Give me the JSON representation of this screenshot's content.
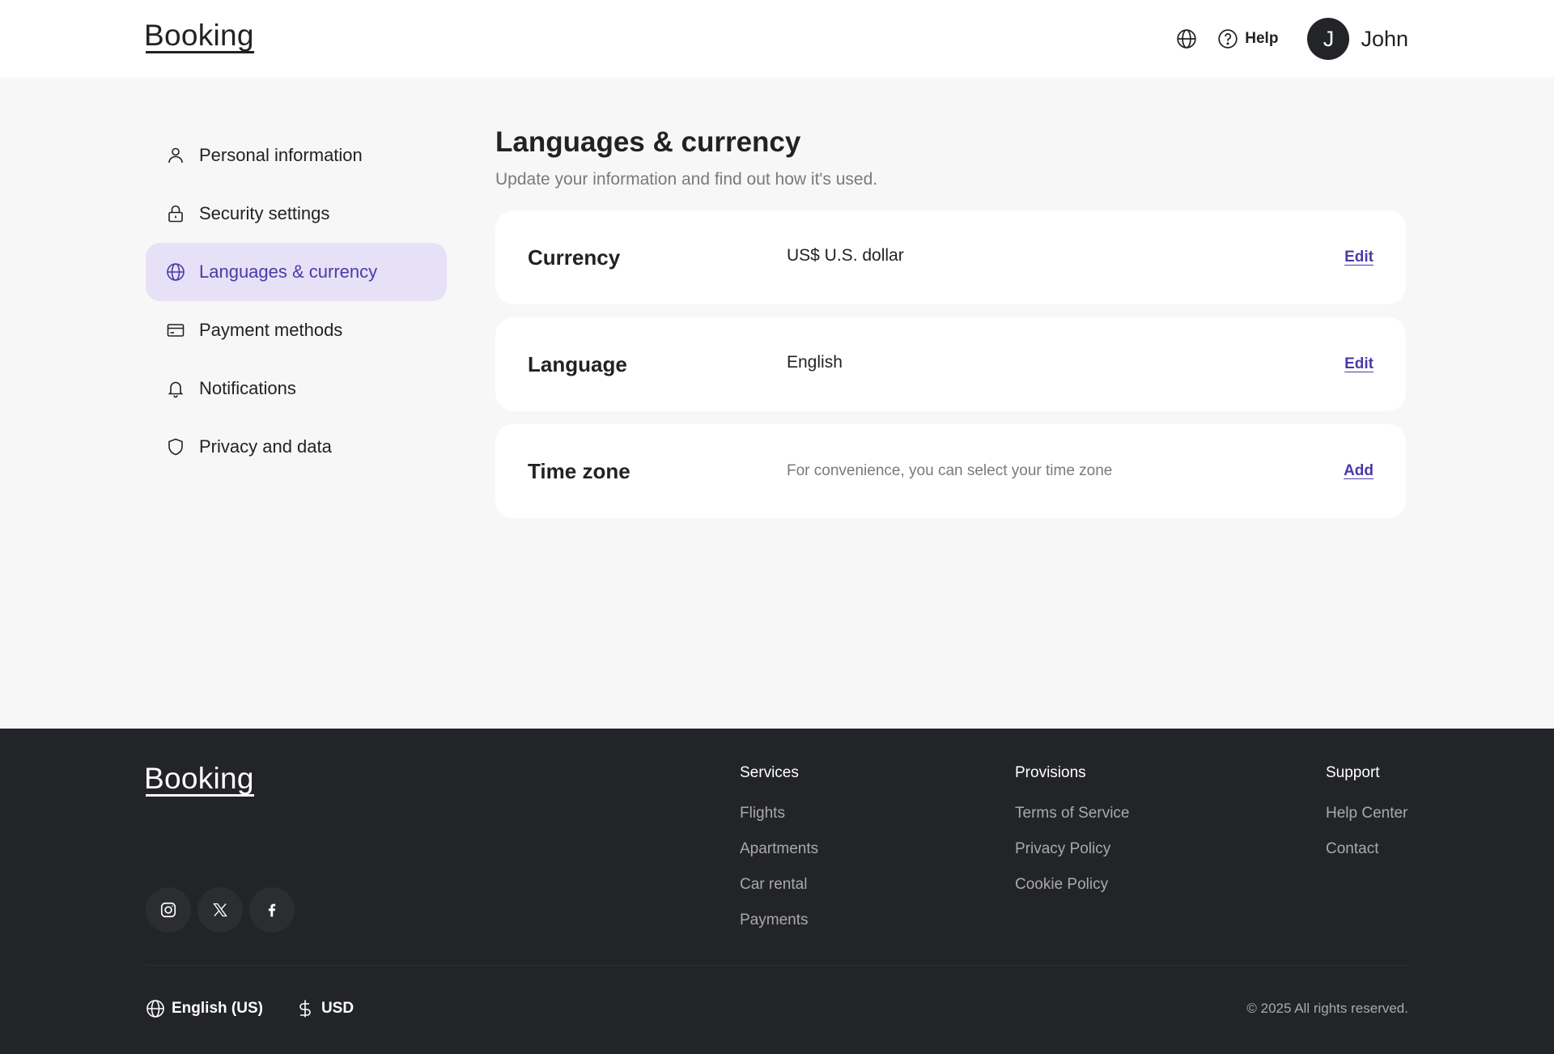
{
  "header": {
    "logo": "Booking",
    "help_label": "Help",
    "avatar_initial": "J",
    "user_name": "John"
  },
  "sidebar": {
    "items": [
      {
        "label": "Personal information",
        "icon": "user-icon"
      },
      {
        "label": "Security settings",
        "icon": "lock-icon"
      },
      {
        "label": "Languages & currency",
        "icon": "globe-icon",
        "active": true
      },
      {
        "label": "Payment methods",
        "icon": "credit-card-icon"
      },
      {
        "label": "Notifications",
        "icon": "bell-icon"
      },
      {
        "label": "Privacy and data",
        "icon": "shield-icon"
      }
    ]
  },
  "main": {
    "title": "Languages & currency",
    "subtitle": "Update your information and find out how it's used.",
    "cards": [
      {
        "label": "Currency",
        "value": "US$ U.S. dollar",
        "action": "Edit"
      },
      {
        "label": "Language",
        "value": "English",
        "action": "Edit"
      },
      {
        "label": "Time zone",
        "value": "For convenience, you can select your time zone",
        "action": "Add"
      }
    ]
  },
  "footer": {
    "logo": "Booking",
    "columns": [
      {
        "title": "Services",
        "links": [
          "Flights",
          "Apartments",
          "Car rental",
          "Payments"
        ]
      },
      {
        "title": "Provisions",
        "links": [
          "Terms of Service",
          "Privacy Policy",
          "Cookie Policy"
        ]
      },
      {
        "title": "Support",
        "links": [
          "Help Center",
          "Contact"
        ]
      }
    ],
    "language": "English (US)",
    "currency": "USD",
    "copyright": "© 2025 All rights reserved."
  },
  "colors": {
    "accent": "#4a3aa7",
    "active_bg": "#e6e1f6",
    "footer_bg": "#232428",
    "page_bg": "#f7f7f8"
  }
}
